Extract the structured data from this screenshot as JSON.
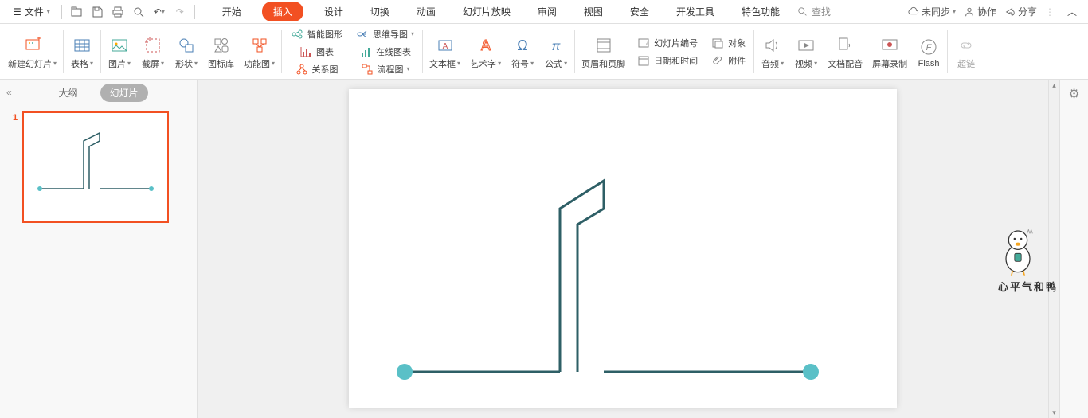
{
  "menu": {
    "file": "文件",
    "tabs": [
      "开始",
      "插入",
      "设计",
      "切换",
      "动画",
      "幻灯片放映",
      "审阅",
      "视图",
      "安全",
      "开发工具",
      "特色功能"
    ],
    "active_tab_index": 1,
    "search_placeholder": "查找"
  },
  "top_right": {
    "unsync": "未同步",
    "collab": "协作",
    "share": "分享"
  },
  "ribbon": {
    "new_slide": "新建幻灯片",
    "table": "表格",
    "picture": "图片",
    "screenshot": "截屏",
    "shape": "形状",
    "icon_lib": "图标库",
    "fn_chart": "功能图",
    "smart_shape": "智能图形",
    "chart": "图表",
    "relation": "关系图",
    "mindmap": "思维导图",
    "online_chart": "在线图表",
    "flowchart": "流程图",
    "textbox": "文本框",
    "wordart": "艺术字",
    "symbol": "符号",
    "equation": "公式",
    "header_footer": "页眉和页脚",
    "slide_num": "幻灯片编号",
    "datetime": "日期和时间",
    "object": "对象",
    "attachment": "附件",
    "audio": "音频",
    "video": "视频",
    "doc_voice": "文档配音",
    "screen_rec": "屏幕录制",
    "flash": "Flash",
    "hyperlink": "超链"
  },
  "sidebar": {
    "outline": "大纲",
    "slides": "幻灯片",
    "active": "slides",
    "slide_numbers": [
      "1"
    ]
  },
  "mascot": {
    "text": "心平气和鸭"
  }
}
